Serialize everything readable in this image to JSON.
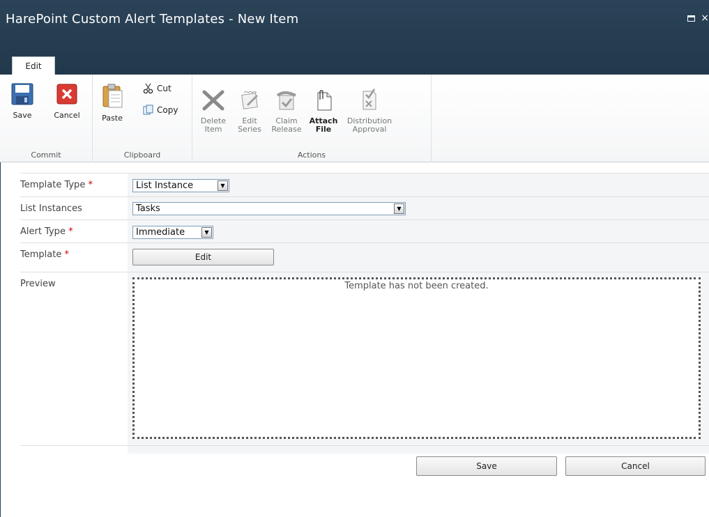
{
  "window": {
    "title": "HarePoint Custom Alert Templates - New Item",
    "close_glyph": "×"
  },
  "ribbon": {
    "active_tab": "Edit",
    "groups": {
      "commit": {
        "label": "Commit",
        "save": "Save",
        "cancel": "Cancel"
      },
      "clipboard": {
        "label": "Clipboard",
        "paste": "Paste",
        "cut": "Cut",
        "copy": "Copy"
      },
      "actions": {
        "label": "Actions",
        "delete_item_1": "Delete",
        "delete_item_2": "Item",
        "edit_series_1": "Edit",
        "edit_series_2": "Series",
        "claim_release_1": "Claim",
        "claim_release_2": "Release",
        "attach_file_1": "Attach",
        "attach_file_2": "File",
        "distribution_approval_1": "Distribution",
        "distribution_approval_2": "Approval"
      }
    }
  },
  "form": {
    "template_type": {
      "label": "Template Type",
      "required": "*",
      "value": "List Instance"
    },
    "list_instances": {
      "label": "List Instances",
      "value": "Tasks"
    },
    "alert_type": {
      "label": "Alert Type",
      "required": "*",
      "value": "Immediate"
    },
    "template": {
      "label": "Template",
      "required": "*",
      "button": "Edit"
    },
    "preview": {
      "label": "Preview",
      "text": "Template has not been created."
    }
  },
  "footer": {
    "save": "Save",
    "cancel": "Cancel"
  },
  "colors": {
    "titlebar": "#22384b",
    "required": "#cc0000",
    "select_border": "#7f9db9"
  }
}
